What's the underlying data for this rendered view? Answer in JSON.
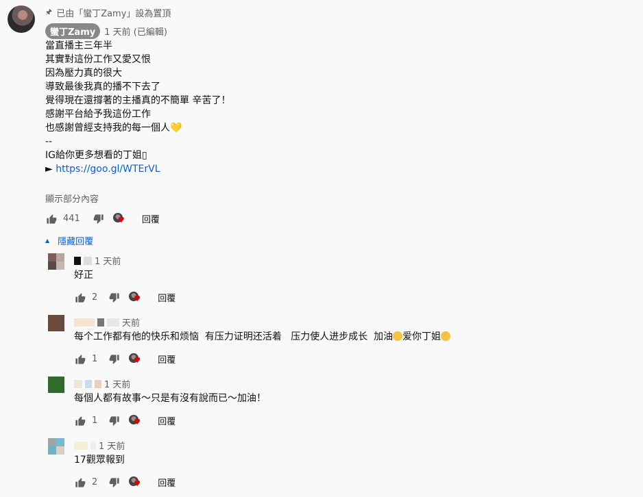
{
  "comment": {
    "pinned_text": "已由「蠻丁Zamy」設為置頂",
    "author": "蠻丁Zamy",
    "time": "1 天前 (已編輯)",
    "lines": [
      "當直播主三年半",
      "其實對這份工作又愛又恨",
      "因為壓力真的很大",
      "導致最後我真的播不下去了",
      "覺得現在還撐著的主播真的不簡單 辛苦了！",
      "",
      "感謝平台給予我這份工作",
      "也感謝曾經支持我的每一個人",
      "--",
      "IG給你更多想看的丁姐",
      "https://goo.gl/WTErVL"
    ],
    "heart_emoji": "💛",
    "ig_suffix": "▯",
    "link_prefix": "►",
    "show_more": "顯示部分內容",
    "likes": "441",
    "reply_label": "回覆"
  },
  "replies_toggle": {
    "label": "隱藏回覆",
    "icon": "caret-up-icon"
  },
  "replies": [
    {
      "time": "1 天前",
      "text": "好正",
      "likes": "2",
      "avatar_colors": [
        "#7d5c5c",
        "#b8a5a0",
        "#5a4848",
        "#c9b5b0"
      ],
      "reply_label": "回覆"
    },
    {
      "time": "天前",
      "text": "每个工作都有他的快乐和烦恼  有压力证明还活着   压力使人进步成长  加油",
      "text_tail": "爱你丁姐",
      "likes": "1",
      "avatar_colors": [
        "#6b4a3e",
        "#6b4a3e",
        "#6b4a3e",
        "#6b4a3e"
      ],
      "reply_label": "回覆"
    },
    {
      "time": "1 天前",
      "text": "每個人都有故事～只是有沒有說而已～加油！",
      "likes": "1",
      "avatar_colors": [
        "#2f6b2a",
        "#2f6b2a",
        "#2f6b2a",
        "#2f6b2a"
      ],
      "reply_label": "回覆"
    },
    {
      "time": "1 天前",
      "text": "17觀眾報到",
      "likes": "2",
      "avatar_colors": [
        "#9aa6a8",
        "#7ab7d1",
        "#6fb3c9",
        "#d9d0c4"
      ],
      "reply_label": "回覆"
    }
  ],
  "colors": {
    "link": "#065fd4",
    "heart": "#e60000",
    "secondary_text": "#606060"
  }
}
